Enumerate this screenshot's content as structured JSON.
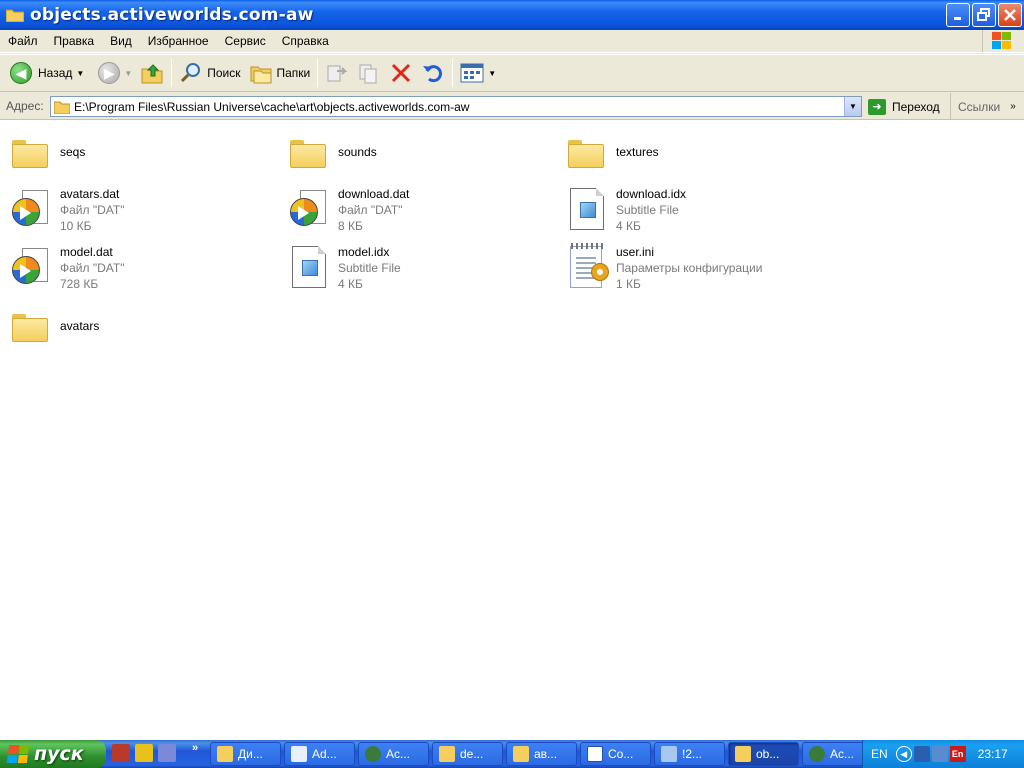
{
  "window": {
    "title": "objects.activeworlds.com-aw"
  },
  "menu": [
    "Файл",
    "Правка",
    "Вид",
    "Избранное",
    "Сервис",
    "Справка"
  ],
  "toolbar": {
    "back_label": "Назад",
    "search_label": "Поиск",
    "folders_label": "Папки"
  },
  "address": {
    "label": "Адрес:",
    "path": "E:\\Program Files\\Russian Universe\\cache\\art\\objects.activeworlds.com-aw",
    "go_label": "Переход",
    "links_label": "Ссылки"
  },
  "files": [
    {
      "name": "seqs",
      "type": "",
      "size": "",
      "icon": "folder-icon"
    },
    {
      "name": "sounds",
      "type": "",
      "size": "",
      "icon": "folder-icon"
    },
    {
      "name": "textures",
      "type": "",
      "size": "",
      "icon": "folder-icon"
    },
    {
      "name": "avatars.dat",
      "type": "Файл \"DAT\"",
      "size": "10 КБ",
      "icon": "media-file-icon"
    },
    {
      "name": "download.dat",
      "type": "Файл \"DAT\"",
      "size": "8 КБ",
      "icon": "media-file-icon"
    },
    {
      "name": "download.idx",
      "type": "Subtitle File",
      "size": "4 КБ",
      "icon": "subtitle-file-icon"
    },
    {
      "name": "model.dat",
      "type": "Файл \"DAT\"",
      "size": "728 КБ",
      "icon": "media-file-icon"
    },
    {
      "name": "model.idx",
      "type": "Subtitle File",
      "size": "4 КБ",
      "icon": "subtitle-file-icon"
    },
    {
      "name": "user.ini",
      "type": "Параметры конфигурации",
      "size": "1 КБ",
      "icon": "config-file-icon"
    },
    {
      "name": "avatars",
      "type": "",
      "size": "",
      "icon": "folder-icon"
    }
  ],
  "taskbar": {
    "start_label": "пуск",
    "tasks": [
      {
        "label": "Ди...",
        "icon": "folder-icon"
      },
      {
        "label": "Ad...",
        "icon": "app-icon"
      },
      {
        "label": "Ac...",
        "icon": "app-icon"
      },
      {
        "label": "de...",
        "icon": "folder-icon"
      },
      {
        "label": "ав...",
        "icon": "folder-icon"
      },
      {
        "label": "Co...",
        "icon": "word-icon"
      },
      {
        "label": "!2...",
        "icon": "app-icon"
      },
      {
        "label": "ob...",
        "icon": "folder-icon"
      },
      {
        "label": "Ac...",
        "icon": "app-icon"
      }
    ],
    "lang": "EN",
    "tray_lang_badge": "En",
    "clock": "23:17"
  },
  "colors": {
    "titlebar": "#0a52d8",
    "taskbar": "#2157d7",
    "start": "#2f8f2f",
    "window_bg": "#ece9d8"
  }
}
